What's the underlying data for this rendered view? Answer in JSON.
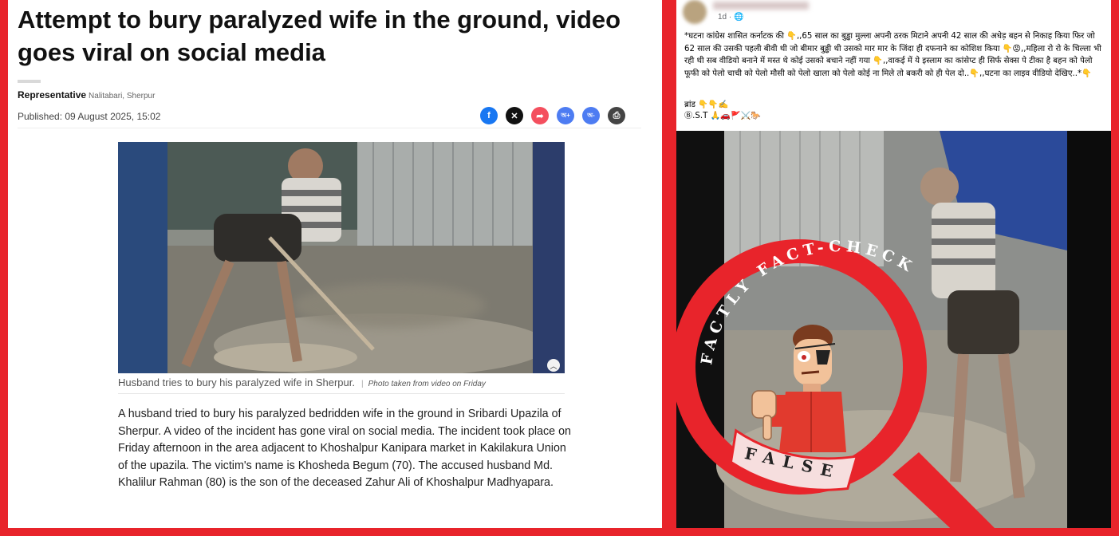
{
  "article": {
    "headline": "Attempt to bury paralyzed wife in the ground, video goes viral on social media",
    "author": "Representative",
    "location": "Nalitabari, Sherpur",
    "published": "Published: 09 August 2025, 15:02",
    "share_buttons": [
      {
        "icon": "facebook-icon",
        "glyph": "f",
        "color": "#1877f2"
      },
      {
        "icon": "x-icon",
        "glyph": "✕",
        "color": "#111111"
      },
      {
        "icon": "share-icon",
        "glyph": "➦",
        "color": "#f44f5e"
      },
      {
        "icon": "font-increase-icon",
        "glyph": "অ+",
        "color": "#4d7cf2"
      },
      {
        "icon": "font-decrease-icon",
        "glyph": "অ-",
        "color": "#4d7cf2"
      },
      {
        "icon": "print-icon",
        "glyph": "⎙",
        "color": "#444444"
      }
    ],
    "photo_caption": "Husband tries to bury his paralyzed wife in Sherpur.",
    "photo_credit": "Photo taken from video on Friday",
    "body": "A husband tried to bury his paralyzed bedridden wife in the ground in Sribardi Upazila of Sherpur. A video of the incident has gone viral on social media. The incident took place on Friday afternoon in the area adjacent to Khoshalpur Kanipara market in Kakilakura Union of the upazila. The victim's name is Khosheda Begum (70). The accused husband Md. Khalilur Rahman (80) is the son of the deceased Zahur Ali of Khoshalpur Madhyapara."
  },
  "post": {
    "meta": "1d · 🌐",
    "text": "*घटना कांग्रेस शासित कर्नाटक की 👇,,65 साल का बुड्ढा मुल्ला अपनी ठरक मिटाने अपनी 42 साल की अधेड़ बहन से निकाह किया फिर जो 62 साल की उसकी पहली बीवी थी जो बीमार बुढ्ढी थी उसको मार मार के जिंदा ही दफनाने का कोशिश किया 👇😡,,महिला रो रो के चिल्ला भी रही थी सब वीडियो बनाने में मस्त थे कोई उसको बचाने नहीं गया 👇,,वाकई में ये इस्लाम का कांसेप्ट ही सिर्फ सेक्स पे टीका है बहन को पेलो फूफी को पेलो चाची को पेलो मौसी को पेलो खाला को पेलो कोई ना मिले तो बकरी को ही पेल दो..👇,,घटना का लाइव वीडियो देखिए..*👇",
    "tag_line1": "ब्रांड 👇👇✍️",
    "tag_line2": "Ⓑ.S.T 🙏🚗🚩⚔️🐎"
  },
  "stamp": {
    "arc_text": "FACTLY FACT-CHECK",
    "verdict": "FALSE",
    "color": "#e8242b"
  },
  "colors": {
    "brand_red": "#e8242b"
  }
}
